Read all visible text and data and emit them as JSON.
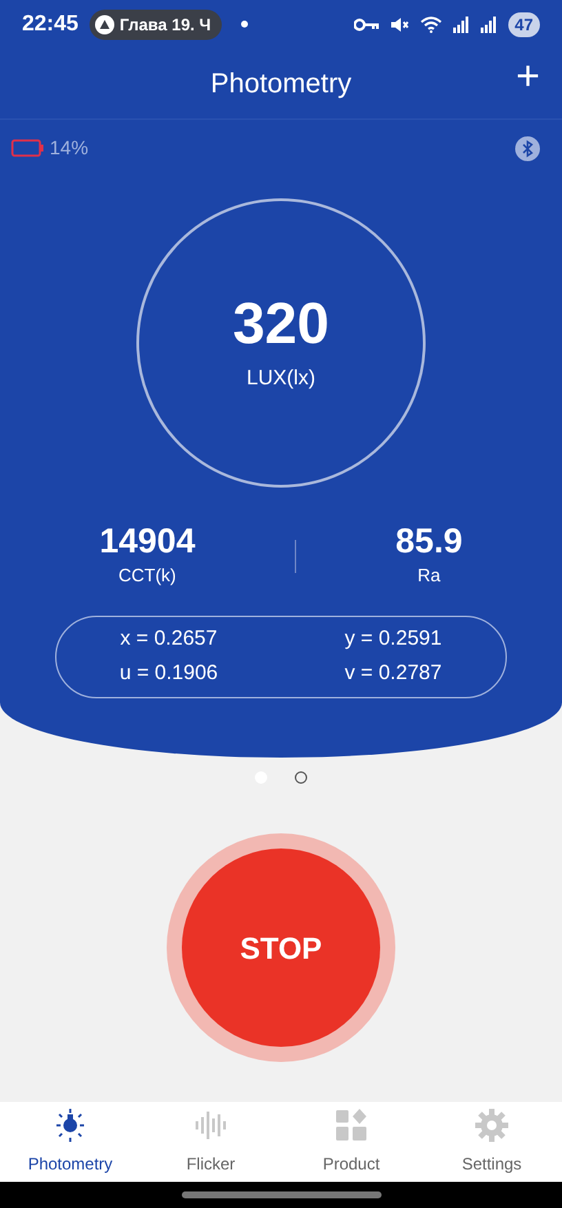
{
  "status_bar": {
    "time": "22:45",
    "notification": "Глава 19. Ч",
    "battery": "47"
  },
  "header": {
    "title": "Photometry",
    "add_icon": "+"
  },
  "device": {
    "battery": "14%"
  },
  "main_reading": {
    "value": "320",
    "unit": "LUX(lx)"
  },
  "stats": [
    {
      "value": "14904",
      "label": "CCT(k)"
    },
    {
      "value": "85.9",
      "label": "Ra"
    }
  ],
  "coordinates": [
    "x = 0.2657",
    "y = 0.2591",
    "u = 0.1906",
    "v = 0.2787"
  ],
  "pages": [
    {
      "selected": true
    },
    {
      "selected": false
    }
  ],
  "stop_button": {
    "label": "STOP"
  },
  "nav": [
    {
      "label": "Photometry",
      "selected": true
    },
    {
      "label": "Flicker",
      "selected": false
    },
    {
      "label": "Product",
      "selected": false
    },
    {
      "label": "Settings",
      "selected": false
    }
  ]
}
